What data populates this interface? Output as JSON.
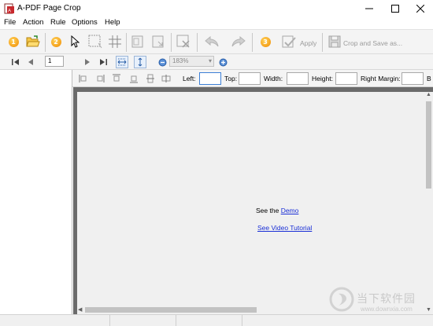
{
  "window": {
    "title": "A-PDF Page Crop"
  },
  "menu": {
    "items": [
      "File",
      "Action",
      "Rule",
      "Options",
      "Help"
    ]
  },
  "toolbar": {
    "step1_badge": "1",
    "step2_badge": "2",
    "step3_badge": "3",
    "apply_label": "Apply",
    "crop_save_label": "Crop and Save as..."
  },
  "navigation": {
    "page_number": "1",
    "zoom_value": "183%"
  },
  "crop_fields": {
    "left_label": "Left:",
    "top_label": "Top:",
    "width_label": "Width:",
    "height_label": "Height:",
    "right_margin_label": "Right Margin:",
    "bottom_margin_label": "B"
  },
  "viewer": {
    "see_the": "See the",
    "demo_link": "Demo",
    "video_link": "See Video Tutorial"
  },
  "watermark": {
    "text": "当下软件园",
    "sub": "www.downxia.com"
  },
  "colors": {
    "link": "#1a2fd6",
    "badge": "#f08a00",
    "viewer_bg": "#6b6b6b"
  }
}
